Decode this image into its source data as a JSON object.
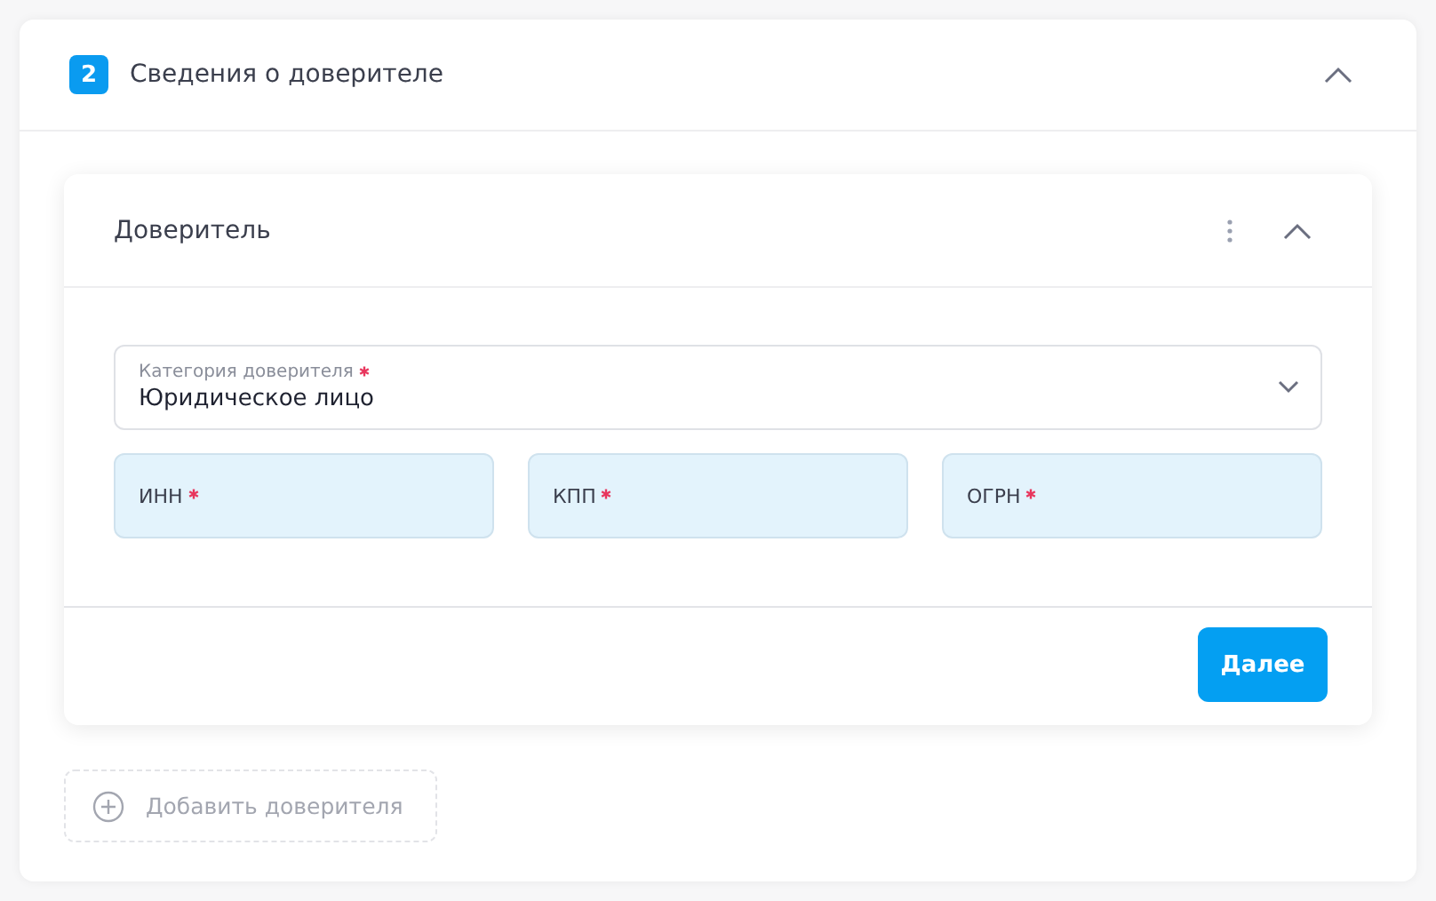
{
  "section": {
    "step": "2",
    "title": "Сведения о доверителе",
    "expanded": true
  },
  "principal": {
    "title": "Доверитель",
    "expanded": true,
    "category": {
      "label": "Категория доверителя",
      "required": true,
      "value": "Юридическое лицо"
    },
    "fields": [
      {
        "label": "ИНН",
        "required": true
      },
      {
        "label": "КПП",
        "required": true
      },
      {
        "label": "ОГРН",
        "required": true
      }
    ],
    "next_button": "Далее"
  },
  "add_button": {
    "label": "Добавить доверителя",
    "disabled": true
  }
}
